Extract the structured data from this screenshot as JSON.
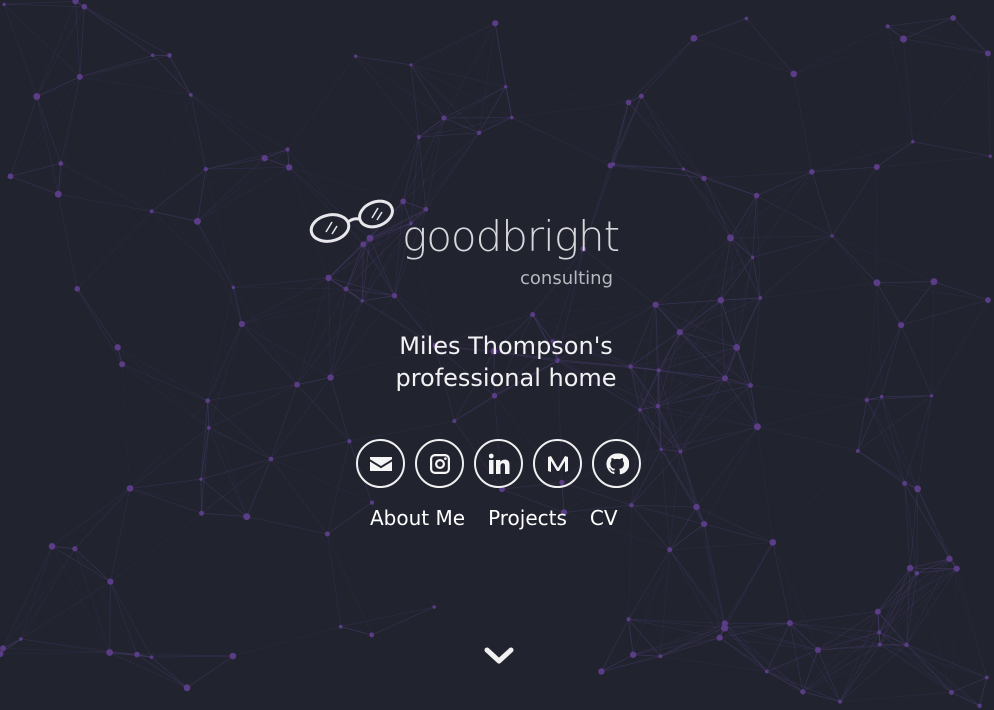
{
  "theme": {
    "background": "#21232f",
    "network_line": "#4a3e6e",
    "network_node": "#5b3c86",
    "text": "#f2f2f4"
  },
  "brand": {
    "logo_text": "goodbright",
    "logo_subtext": "consulting",
    "logo_icon": "glasses-icon"
  },
  "hero": {
    "headline_line1": "Miles Thompson's",
    "headline_line2": "professional home"
  },
  "social_links": [
    {
      "name": "email",
      "icon": "envelope-icon"
    },
    {
      "name": "instagram",
      "icon": "instagram-icon"
    },
    {
      "name": "linkedin",
      "icon": "linkedin-icon"
    },
    {
      "name": "medium",
      "icon": "medium-icon"
    },
    {
      "name": "github",
      "icon": "github-icon"
    }
  ],
  "nav": {
    "about": "About Me",
    "projects": "Projects",
    "cv": "CV"
  },
  "scroll_indicator": {
    "icon": "chevron-down-icon"
  }
}
